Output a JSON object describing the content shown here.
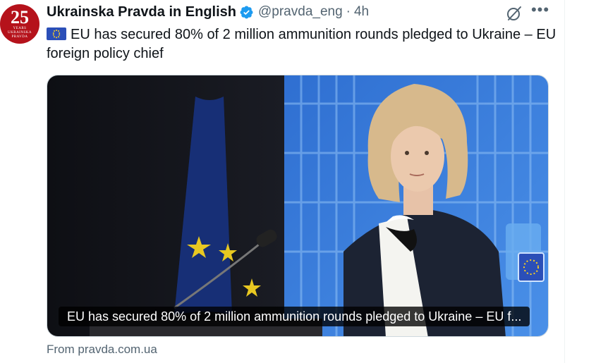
{
  "account": {
    "avatar_number": "25",
    "avatar_sub1": "YEARS",
    "avatar_sub2": "UKRAINSKA PRAVDA",
    "display_name": "Ukrainska Pravda in English",
    "handle": "@pravda_eng",
    "separator": "·",
    "time": "4h"
  },
  "tweet": {
    "text": "EU has secured 80% of 2 million ammunition rounds pledged to Ukraine – EU foreign policy chief"
  },
  "card": {
    "caption": "EU has secured 80% of 2 million ammunition rounds pledged to Ukraine – EU f...",
    "source": "From pravda.com.ua"
  },
  "icons": {
    "verified": "verified-badge-icon",
    "grok": "grok-icon",
    "more": "more-options-icon",
    "flag": "eu-flag-icon"
  },
  "colors": {
    "accent": "#1d9bf0",
    "secondary_text": "#536471",
    "avatar": "#b5121b"
  }
}
